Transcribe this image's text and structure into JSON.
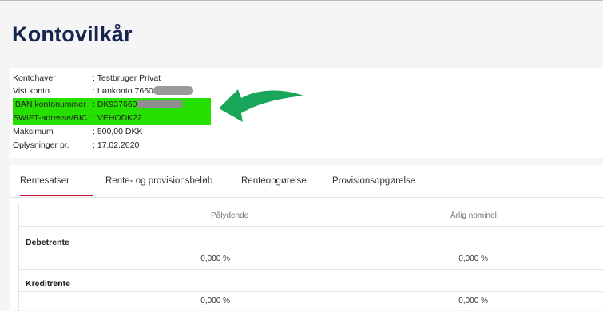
{
  "page": {
    "title": "Kontovilkår"
  },
  "account_info": [
    {
      "label": "Kontohaver",
      "value": ": Testbruger Privat"
    },
    {
      "label": "Vist konto",
      "value": ": Lønkonto 7660"
    },
    {
      "label": "IBAN kontonummer",
      "value": ": DK937660"
    },
    {
      "label": "SWIFT-adresse/BIC",
      "value": ": VEHODK22"
    },
    {
      "label": "Maksimum",
      "value": ": 500,00 DKK"
    },
    {
      "label": "Oplysninger pr.",
      "value": ": 17.02.2020"
    }
  ],
  "colors": {
    "highlight": "#26e000",
    "arrow": "#1aa65a",
    "title": "#14254f",
    "active_tab": "#b5112e"
  },
  "tabs": [
    {
      "label": "Rentesatser",
      "active": true
    },
    {
      "label": "Rente- og provisionsbeløb"
    },
    {
      "label": "Renteopgørelse"
    },
    {
      "label": "Provisionsopgørelse"
    }
  ],
  "table": {
    "columns": [
      "Pålydende",
      "Årlig nominel"
    ],
    "groups": [
      {
        "label": "Debetrente",
        "values": [
          "0,000 %",
          "0,000 %"
        ]
      },
      {
        "label": "Kreditrente",
        "values": [
          "0,000 %",
          "0,000 %"
        ]
      }
    ]
  }
}
